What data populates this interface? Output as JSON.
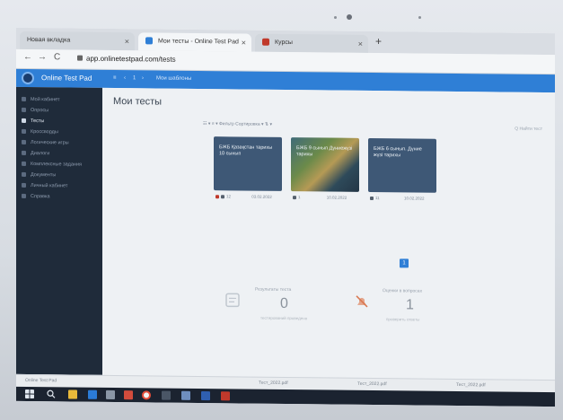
{
  "browser": {
    "tabs": [
      {
        "label": "Новая вкладка",
        "active": false
      },
      {
        "label": "Мои тесты - Online Test Pad",
        "active": true
      },
      {
        "label": "Курсы",
        "active": false
      }
    ],
    "new_tab": "+",
    "url": "app.onlinetestpad.com/tests",
    "back": "←",
    "forward": "→",
    "reload": "C"
  },
  "app": {
    "brand": "Online Test Pad",
    "header_controls": [
      "≡",
      "‹",
      "1",
      "›",
      "Мои шаблоны"
    ]
  },
  "sidebar": {
    "items": [
      {
        "label": "Мой кабинет",
        "active": false
      },
      {
        "label": "Опросы",
        "active": false
      },
      {
        "label": "Тесты",
        "active": true
      },
      {
        "label": "Кроссворды",
        "active": false
      },
      {
        "label": "Логические игры",
        "active": false
      },
      {
        "label": "Диалоги",
        "active": false
      },
      {
        "label": "Комплексные задания",
        "active": false
      },
      {
        "label": "Документы",
        "active": false
      },
      {
        "label": "Личный кабинет",
        "active": false
      },
      {
        "label": "Справка",
        "active": false
      }
    ]
  },
  "main": {
    "title": "Мои тесты",
    "toolbar_text": "☷ ▾  ≡ ▾  Фильтр   Сортировка ▾  ⇅ ▾",
    "search_hint": "Q  Найти тест",
    "cards": [
      {
        "title": "БЖБ Қазақстан тарихы 10 сынып",
        "date": "03.02.2022",
        "count": "12"
      },
      {
        "title": "БЖБ 9 сынып Дүниежүзі тарихы",
        "date": "10.02.2022",
        "count": "1"
      },
      {
        "title": "БЖБ 6 сынып. Дүние жүзі тарихы",
        "date": "10.02.2022",
        "count": "11"
      }
    ],
    "pager": "1",
    "stats": [
      {
        "label": "Результаты теста",
        "value": "0",
        "sub": "тестирований проведено"
      },
      {
        "label": "Оценки в вопросах",
        "value": "1",
        "sub": "проверить ответы"
      }
    ]
  },
  "downloads": [
    "Online Test Pad",
    "Тест_2022.pdf",
    "Тест_2022.pdf",
    "Тест_2022.pdf"
  ],
  "colors": {
    "header": "#2f7fd6",
    "sidebar": "#1f2b3a",
    "card": "#3e5876"
  }
}
